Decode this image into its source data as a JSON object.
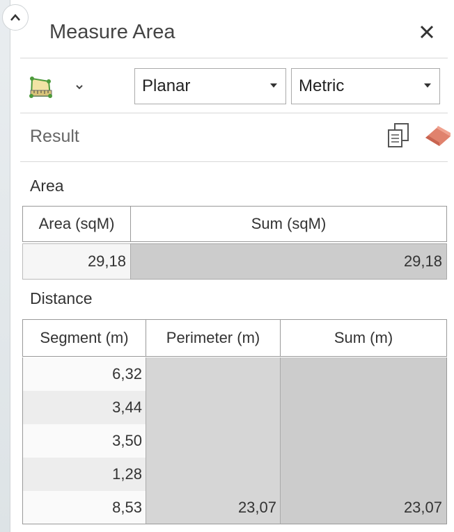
{
  "panel": {
    "title": "Measure Area",
    "mode_select": "Planar",
    "unit_select": "Metric",
    "result_label": "Result"
  },
  "icons": {
    "collapse": "chevron-up-icon",
    "close": "close-icon",
    "measure_tool": "measure-area-tool-icon",
    "dropdown": "chevron-down-icon",
    "copy": "copy-icon",
    "clear": "eraser-icon"
  },
  "area": {
    "label": "Area",
    "headers": [
      "Area (sqM)",
      "Sum (sqM)"
    ],
    "values": [
      "29,18",
      "29,18"
    ]
  },
  "distance": {
    "label": "Distance",
    "headers": [
      "Segment (m)",
      "Perimeter (m)",
      "Sum (m)"
    ],
    "segments": [
      "6,32",
      "3,44",
      "3,50",
      "1,28",
      "8,53"
    ],
    "perimeter": "23,07",
    "sum": "23,07"
  },
  "colors": {
    "total_cell_bg": "#cccccc",
    "stripe_row_bg": "#ededed",
    "eraser": "#e0826d"
  }
}
